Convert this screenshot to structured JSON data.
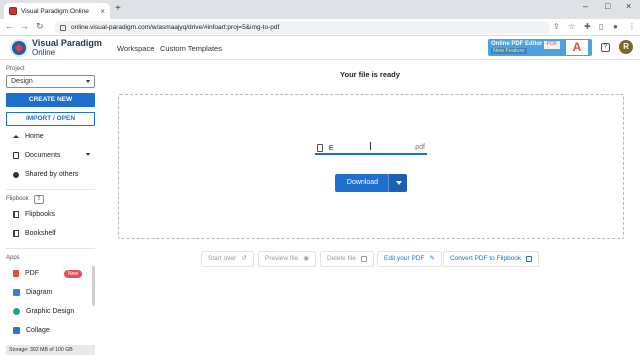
{
  "browser": {
    "tab_title": "Visual Paradigm Online",
    "tab_close": "×",
    "new_tab": "+",
    "url": "online.visual-paradigm.com/w/asmaajyq/drive/#infoart:proj=5&img-to-pdf",
    "window_controls": [
      "–",
      "□",
      "×"
    ]
  },
  "header": {
    "logo_line1": "Visual Paradigm",
    "logo_line2": "Online",
    "nav": [
      "Workspace",
      "Custom Templates"
    ],
    "promo_line1": "Online PDF Editor",
    "promo_line2": "New Feature",
    "promo_pdf": "PDF",
    "promo_a": "A",
    "help": "?",
    "avatar_initial": "R"
  },
  "sidebar": {
    "project_label": "Project",
    "project_value": "Design",
    "create_new": "CREATE NEW",
    "import_open": "IMPORT / OPEN",
    "items": [
      {
        "label": "Home"
      },
      {
        "label": "Documents"
      },
      {
        "label": "Shared by others"
      }
    ],
    "flipbook_label": "Flipbook",
    "flipbook_items": [
      {
        "label": "Flipbooks"
      },
      {
        "label": "Bookshelf"
      }
    ],
    "apps_label": "Apps",
    "apps": [
      {
        "label": "PDF",
        "badge": "New"
      },
      {
        "label": "Diagram"
      },
      {
        "label": "Graphic Design"
      },
      {
        "label": "Collage"
      }
    ],
    "storage": "Storage: 392 MB of 100 GB"
  },
  "main": {
    "title": "Your file is ready",
    "filename_value": "E",
    "extension": ".pdf",
    "download": "Download",
    "actions": [
      {
        "label": "Start over",
        "enabled": false
      },
      {
        "label": "Preview file",
        "enabled": false
      },
      {
        "label": "Delete file",
        "enabled": false
      },
      {
        "label": "Edit your PDF",
        "enabled": true
      },
      {
        "label": "Convert PDF to Flipbook",
        "enabled": true
      }
    ]
  },
  "colors": {
    "primary": "#1f6fcf",
    "badge_new": "#ea4d5f",
    "avatar": "#7a6a2a"
  }
}
